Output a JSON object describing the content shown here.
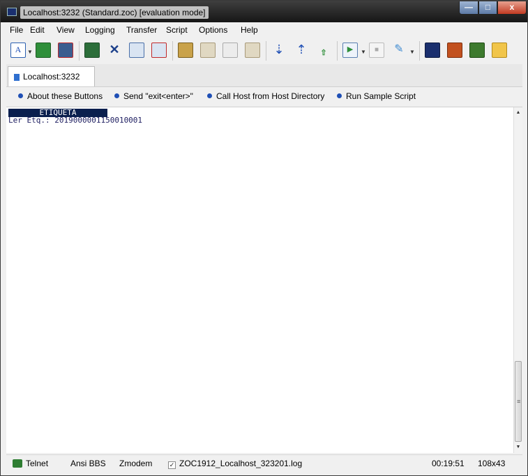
{
  "window": {
    "title": "Localhost:3232 (Standard.zoc) [evaluation mode]",
    "minimize": "—",
    "maximize": "□",
    "close": "x"
  },
  "menu": [
    "File",
    "Edit",
    "View",
    "Logging",
    "Transfer",
    "Script",
    "Options",
    "Help"
  ],
  "toolbar": {
    "icons": [
      "font-icon",
      "connect-session-icon",
      "disconnect-session-icon",
      "copy-session-icon",
      "delete-session-icon",
      "new-session-icon",
      "close-session-icon",
      "clipboard-icon",
      "paste-icon",
      "edit-paste-icon",
      "copy-clip-icon",
      "download-icon",
      "upload-icon",
      "spellcheck-icon",
      "play-script-icon",
      "stop-script-icon",
      "edit-script-icon",
      "terminal-icon",
      "target-icon",
      "notes-icon",
      "folder-icon"
    ]
  },
  "tab": {
    "label": "Localhost:3232"
  },
  "buttons": [
    "About these Buttons",
    "Send \"exit<enter>\"",
    "Call Host from Host Directory",
    "Run Sample Script"
  ],
  "terminal": {
    "highlight": "ETIQUETA",
    "line1": "Ler Etq.: 2019000001150010001"
  },
  "status": {
    "protocol": "Telnet",
    "emulation": "Ansi BBS",
    "transfer": "Zmodem",
    "log_checked": "✓",
    "log_file": "ZOC1912_Localhost_323201.log",
    "time": "00:19:51",
    "size": "108x43"
  },
  "colors": {
    "accent": "#1f4fb5",
    "terminal_text": "#1d1d60",
    "highlight_bg": "#0a1f4e"
  }
}
